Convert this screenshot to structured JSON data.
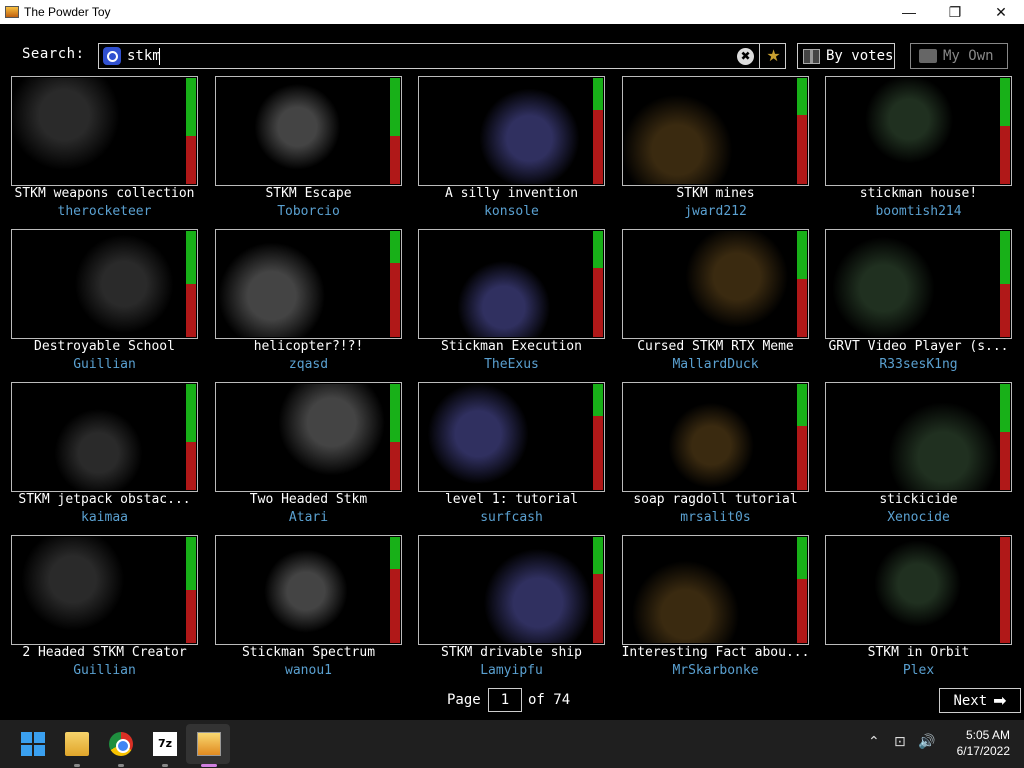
{
  "window": {
    "title": "The Powder Toy",
    "minimize": "—",
    "maximize": "❐",
    "close": "✕"
  },
  "search": {
    "label": "Search:",
    "query": "stkm",
    "clear_glyph": "✖",
    "fav_glyph": "★"
  },
  "sort": {
    "label": "By votes"
  },
  "own": {
    "label": "My Own"
  },
  "saves": [
    {
      "title": "STKM weapons collection",
      "author": "therocketeer",
      "up": 0.55
    },
    {
      "title": "STKM Escape",
      "author": "Toborcio",
      "up": 0.55
    },
    {
      "title": "A silly invention",
      "author": "konsole",
      "up": 0.3
    },
    {
      "title": "STKM mines",
      "author": "jward212",
      "up": 0.35
    },
    {
      "title": "stickman house!",
      "author": "boomtish214",
      "up": 0.45
    },
    {
      "title": "Destroyable School",
      "author": "Guillian",
      "up": 0.5
    },
    {
      "title": "helicopter?!?!",
      "author": "zqasd",
      "up": 0.3
    },
    {
      "title": "Stickman Execution",
      "author": "TheExus",
      "up": 0.35
    },
    {
      "title": "Cursed STKM RTX Meme",
      "author": "MallardDuck",
      "up": 0.45
    },
    {
      "title": "GRVT Video Player (s...",
      "author": "R33sesK1ng",
      "up": 0.5
    },
    {
      "title": "STKM jetpack obstac...",
      "author": "kaimaa",
      "up": 0.55
    },
    {
      "title": "Two Headed Stkm",
      "author": "Atari",
      "up": 0.55
    },
    {
      "title": "level 1: tutorial",
      "author": "surfcash",
      "up": 0.3
    },
    {
      "title": "soap ragdoll tutorial",
      "author": "mrsalit0s",
      "up": 0.4
    },
    {
      "title": "stickicide",
      "author": "Xenocide",
      "up": 0.45
    },
    {
      "title": "2 Headed STKM Creator",
      "author": "Guillian",
      "up": 0.5
    },
    {
      "title": "Stickman Spectrum",
      "author": "wanou1",
      "up": 0.3
    },
    {
      "title": "STKM drivable ship",
      "author": "Lamyipfu",
      "up": 0.35
    },
    {
      "title": "Interesting Fact abou...",
      "author": "MrSkarbonke",
      "up": 0.4
    },
    {
      "title": "STKM in Orbit",
      "author": "Plex",
      "up": 0.0
    }
  ],
  "pagination": {
    "page_label": "Page",
    "current": "1",
    "of_label": "of 74",
    "next_label": "Next",
    "next_glyph": "➡"
  },
  "taskbar": {
    "sevenzip_label": "7z",
    "tray_chevron": "⌃",
    "tray_network": "⊡",
    "tray_volume": "🔊",
    "time": "5:05 AM",
    "date": "6/17/2022"
  }
}
